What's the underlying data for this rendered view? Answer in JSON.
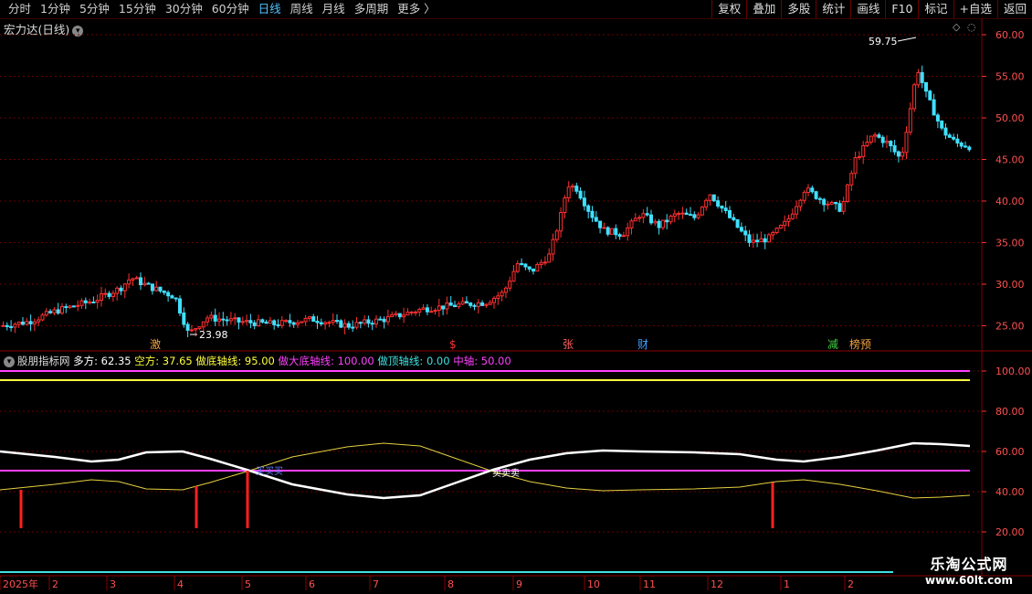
{
  "toolbar": {
    "periods": [
      "分时",
      "1分钟",
      "5分钟",
      "15分钟",
      "30分钟",
      "60分钟",
      "日线",
      "周线",
      "月线",
      "多周期",
      "更多 〉"
    ],
    "active_period": "日线",
    "actions": [
      "复权",
      "叠加",
      "多股",
      "统计",
      "画线",
      "F10",
      "标记",
      "+自选",
      "返回"
    ]
  },
  "main_chart": {
    "title": "宏力达(日线)",
    "high_label": "59.75",
    "low_label": "23.98",
    "y_ticks": [
      "60.00",
      "55.00",
      "50.00",
      "45.00",
      "40.00",
      "35.00",
      "30.00",
      "25.00"
    ],
    "markers": [
      {
        "text": "激",
        "color": "#f0a040"
      },
      {
        "text": "$",
        "color": "#ff3030"
      },
      {
        "text": "张",
        "color": "#ff6060"
      },
      {
        "text": "财",
        "color": "#40a0ff"
      },
      {
        "text": "减",
        "color": "#40d040"
      },
      {
        "text": "榜预",
        "color": "#f0a040"
      }
    ]
  },
  "indicator": {
    "name": "股朋指标网",
    "items": [
      {
        "label": "多方: 62.35",
        "color": "#ffffff"
      },
      {
        "label": "空方: 37.65",
        "color": "#ffff40"
      },
      {
        "label": "做底轴线: 95.00",
        "color": "#ffff40"
      },
      {
        "label": "做大底轴线: 100.00",
        "color": "#ff40ff"
      },
      {
        "label": "做顶轴线: 0.00",
        "color": "#40e0e0"
      },
      {
        "label": "中轴: 50.00",
        "color": "#ff40ff"
      }
    ],
    "y_ticks": [
      "100.00",
      "80.00",
      "60.00",
      "40.00",
      "20.00"
    ],
    "cross_labels": [
      "买买买",
      "卖卖卖"
    ]
  },
  "x_axis": {
    "labels": [
      "2025年",
      "2",
      "3",
      "4",
      "5",
      "6",
      "7",
      "8",
      "9",
      "10",
      "11",
      "12",
      "1",
      "2"
    ]
  },
  "watermark": {
    "line1": "乐淘公式网",
    "line2": "www.60lt.com"
  },
  "colors": {
    "up": "#ff3030",
    "down": "#40e0ff",
    "grid": "#8a0000",
    "long": "#ffffff",
    "short": "#ffff40",
    "axis": "#ff40ff"
  }
}
